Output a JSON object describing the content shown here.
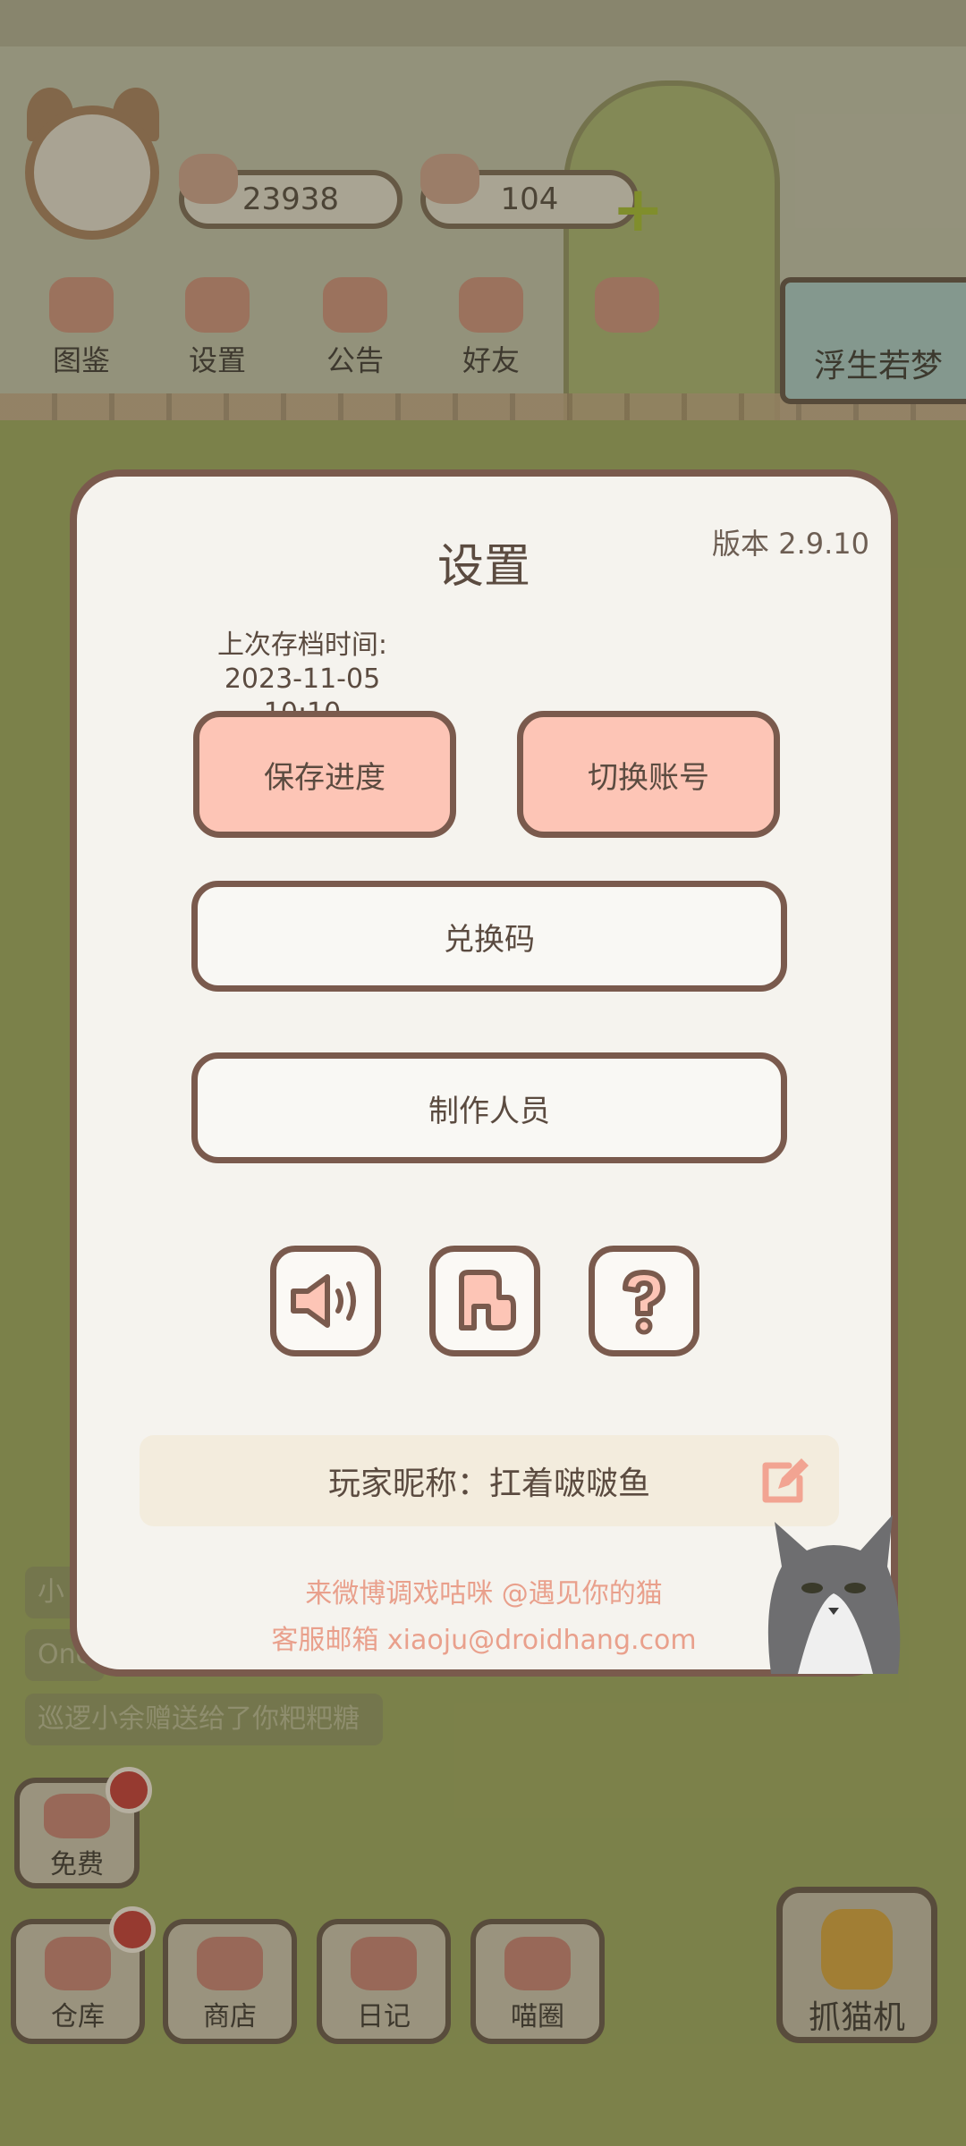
{
  "hud": {
    "fish_count": "23938",
    "heart_count": "104"
  },
  "menu": [
    {
      "label": "图鉴"
    },
    {
      "label": "设置"
    },
    {
      "label": "公告"
    },
    {
      "label": "好友"
    }
  ],
  "banner": {
    "label": "浮生若梦"
  },
  "chat": {
    "lines": [
      "小",
      "One",
      "巡逻小余赠送给了你粑粑糖"
    ]
  },
  "bottom_bar": {
    "free": "免费",
    "warehouse": "仓库",
    "shop": "商店",
    "diary": "日记",
    "circle": "喵圈",
    "grab": "抓猫机"
  },
  "dialog": {
    "title": "设置",
    "version": "版本 2.9.10",
    "save_time_label": "上次存档时间:",
    "save_time_value": "2023-11-05 10:10",
    "save_button": "保存进度",
    "switch_account_button": "切换账号",
    "redeem_button": "兑换码",
    "credits_button": "制作人员",
    "nickname_text": "玩家昵称：扛着啵啵鱼",
    "weibo_text": "来微博调戏咕咪 @遇见你的猫",
    "email_text": "客服邮箱 xiaoju@droidhang.com"
  },
  "colors": {
    "dialog_bg": "#f5f3ee",
    "border": "#7a5a4d",
    "pink_button": "#fdc5b6",
    "footer_text": "#e9a08c"
  }
}
